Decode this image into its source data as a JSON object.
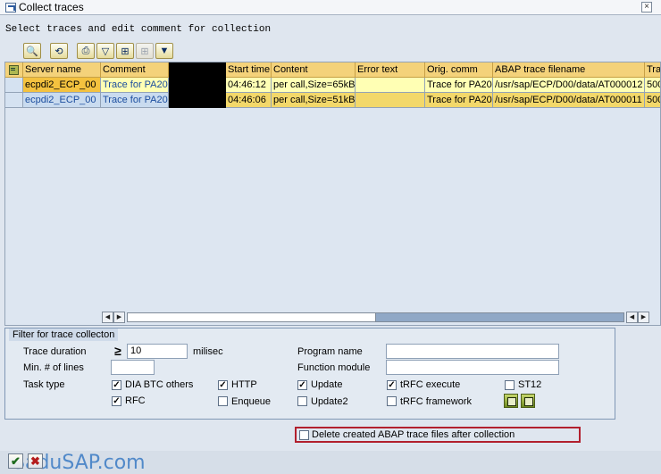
{
  "window": {
    "title": "Collect traces"
  },
  "instruction": "Select traces and edit comment for collection",
  "toolbar": {
    "icons": [
      "details-icon",
      "refresh-icon",
      "print-icon",
      "filter-icon",
      "find-icon",
      "find-next-icon",
      "set-filter-icon"
    ]
  },
  "grid": {
    "columns": [
      "Server name",
      "Comment",
      "",
      "Start time",
      "Content",
      "Error text",
      "Orig. comm",
      "ABAP trace filename",
      "Tra"
    ],
    "rows": [
      [
        "ecpdi2_ECP_00",
        "Trace for PA20",
        "",
        "04:46:12",
        "per call,Size=65kB",
        "",
        "Trace for PA20",
        "/usr/sap/ECP/D00/data/AT000012",
        "500"
      ],
      [
        "ecpdi2_ECP_00",
        "Trace for PA20",
        "",
        "04:46:06",
        "per call,Size=51kB",
        "",
        "Trace for PA20",
        "/usr/sap/ECP/D00/data/AT000011",
        "500"
      ]
    ],
    "scroll_position": 0.5
  },
  "filter": {
    "title": "Filter for trace collecton",
    "trace_duration_label": "Trace duration",
    "operator": "≥",
    "trace_duration_value": "10",
    "unit": "milisec",
    "min_lines_label": "Min. # of lines",
    "min_lines_value": "",
    "task_type_label": "Task type",
    "program_name_label": "Program name",
    "program_name_value": "",
    "function_module_label": "Function module",
    "function_module_value": "",
    "task_types": {
      "dia_btc": {
        "label": "DIA BTC others",
        "checked": true
      },
      "http": {
        "label": "HTTP",
        "checked": true
      },
      "update": {
        "label": "Update",
        "checked": true
      },
      "trfc_execute": {
        "label": "tRFC execute",
        "checked": true
      },
      "st12": {
        "label": "ST12",
        "checked": false
      },
      "rfc": {
        "label": "RFC",
        "checked": true
      },
      "enqueue": {
        "label": "Enqueue",
        "checked": false
      },
      "update2": {
        "label": "Update2",
        "checked": false
      },
      "trfc_framework": {
        "label": "tRFC framework",
        "checked": false
      }
    }
  },
  "delete_option": {
    "label": "Delete created ABAP trace files after collection",
    "checked": false
  },
  "watermark": "SaduSAP.com",
  "colors": {
    "header": "#f4d27a",
    "row": "#ffffb4",
    "key": "#f4c23f",
    "highlight": "#b2202e"
  }
}
